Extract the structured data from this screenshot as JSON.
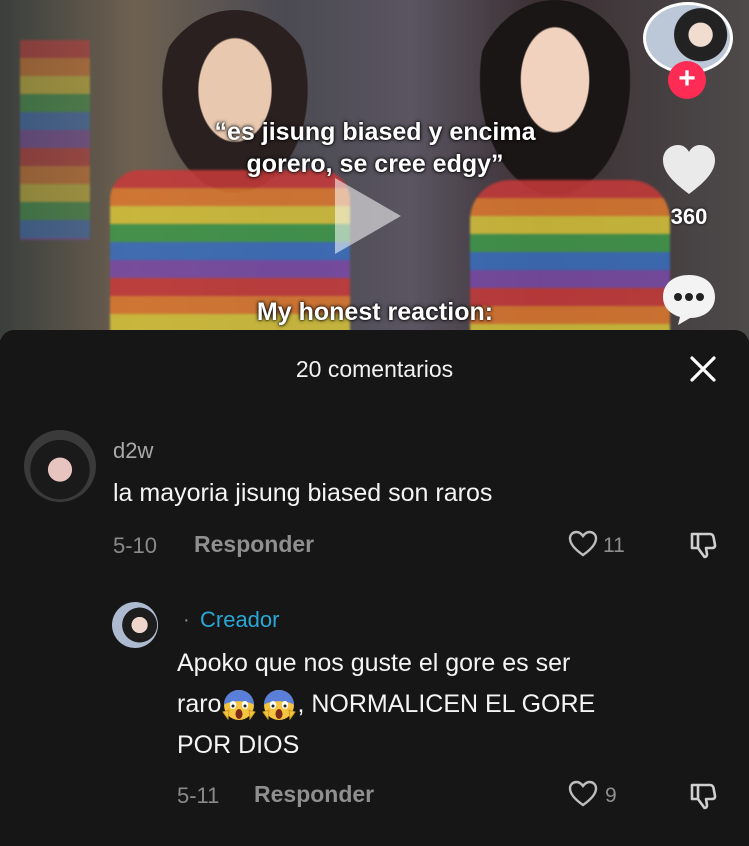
{
  "video": {
    "caption_top": "“es jisung biased y encima gorero, se cree edgy”",
    "caption_bottom": "My honest reaction:",
    "likes": "360",
    "follow_symbol": "+"
  },
  "comments_sheet": {
    "title": "20 comentarios",
    "close_symbol": "✕",
    "comments": [
      {
        "username": "d2w",
        "text": "la mayoria jisung biased son raros",
        "date": "5-10",
        "reply_label": "Responder",
        "likes": "11"
      }
    ],
    "reply": {
      "badge_dot": "·",
      "badge": "Creador",
      "text_line1": "Apoko que nos guste el gore es ser",
      "text_line2_before": "raro",
      "text_line2_after": ", NORMALICEN EL GORE",
      "text_line3": "POR DIOS",
      "date": "5-11",
      "reply_label": "Responder",
      "likes": "9"
    }
  },
  "colors": {
    "sheet_bg": "#161616",
    "follow_red": "#fe2c55",
    "creator_blue": "#2aa7d5"
  }
}
